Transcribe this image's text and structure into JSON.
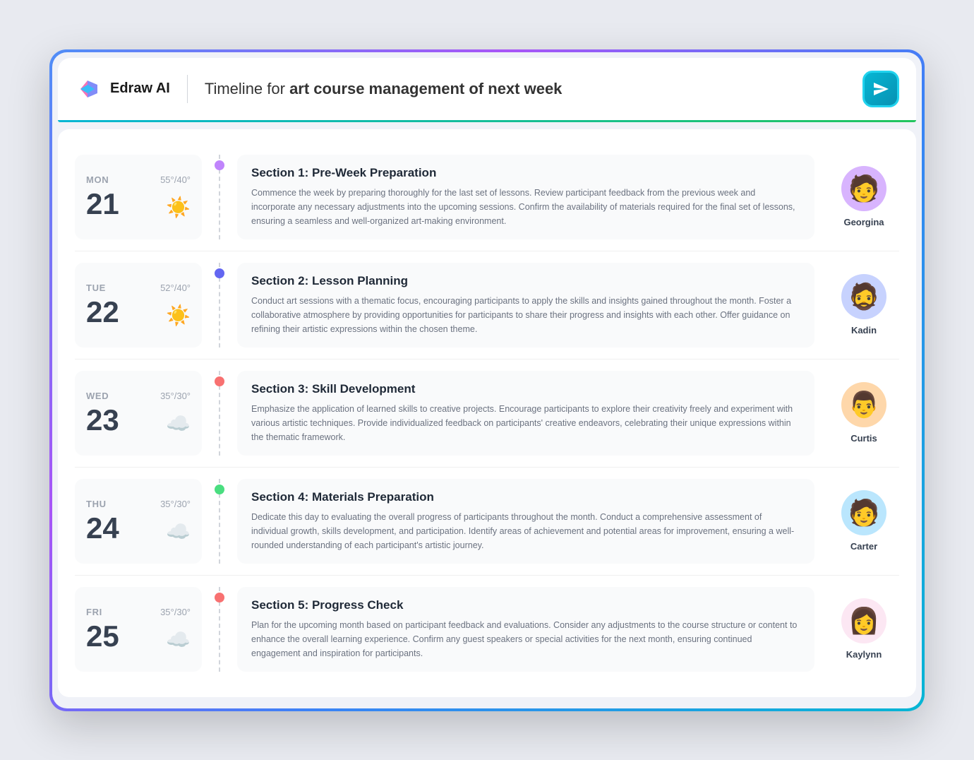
{
  "app": {
    "logo_text": "Edraw AI",
    "title_prefix": "Timeline for ",
    "title_bold": "art course management of next week",
    "send_label": "Send"
  },
  "rows": [
    {
      "day": "MON",
      "date": "21",
      "temp": "55°/40°",
      "weather": "☀️",
      "dot_color": "#c084fc",
      "section_title": "Section 1: Pre-Week Preparation",
      "section_desc": "Commence the week by preparing thoroughly for the last set of lessons. Review participant feedback from the previous week and incorporate any necessary adjustments into the upcoming sessions. Confirm the availability of materials required for the final set of lessons, ensuring a seamless and well-organized art-making environment.",
      "person_name": "Georgina",
      "avatar_class": "avatar-georgina",
      "avatar_emoji": "🧑"
    },
    {
      "day": "TUE",
      "date": "22",
      "temp": "52°/40°",
      "weather": "☀️",
      "dot_color": "#6366f1",
      "section_title": "Section 2: Lesson Planning",
      "section_desc": "Conduct art sessions with a thematic focus, encouraging participants to apply the skills and insights gained throughout the month. Foster a collaborative atmosphere by providing opportunities for participants to share their progress and insights with each other. Offer guidance on refining their artistic expressions within the chosen theme.",
      "person_name": "Kadin",
      "avatar_class": "avatar-kadin",
      "avatar_emoji": "🧔"
    },
    {
      "day": "WED",
      "date": "23",
      "temp": "35°/30°",
      "weather": "☁️",
      "dot_color": "#f87171",
      "section_title": "Section 3: Skill Development",
      "section_desc": "Emphasize the application of learned skills to creative projects. Encourage participants to explore their creativity freely and experiment with various artistic techniques. Provide individualized feedback on participants' creative endeavors, celebrating their unique expressions within the thematic framework.",
      "person_name": "Curtis",
      "avatar_class": "avatar-curtis",
      "avatar_emoji": "👨"
    },
    {
      "day": "THU",
      "date": "24",
      "temp": "35°/30°",
      "weather": "☁️",
      "dot_color": "#4ade80",
      "section_title": "Section 4: Materials Preparation",
      "section_desc": "Dedicate this day to evaluating the overall progress of participants throughout the month. Conduct a comprehensive assessment of individual growth, skills development, and participation. Identify areas of achievement and potential areas for improvement, ensuring a well-rounded understanding of each participant's artistic journey.",
      "person_name": "Carter",
      "avatar_class": "avatar-carter",
      "avatar_emoji": "🧑"
    },
    {
      "day": "FRI",
      "date": "25",
      "temp": "35°/30°",
      "weather": "☁️",
      "dot_color": "#f87171",
      "section_title": "Section 5: Progress Check",
      "section_desc": "Plan for the upcoming month based on participant feedback and evaluations. Consider any adjustments to the course structure or content to enhance the overall learning experience. Confirm any guest speakers or special activities for the next month, ensuring continued engagement and inspiration for participants.",
      "person_name": "Kaylynn",
      "avatar_class": "avatar-kaylynn",
      "avatar_emoji": "👩"
    }
  ]
}
